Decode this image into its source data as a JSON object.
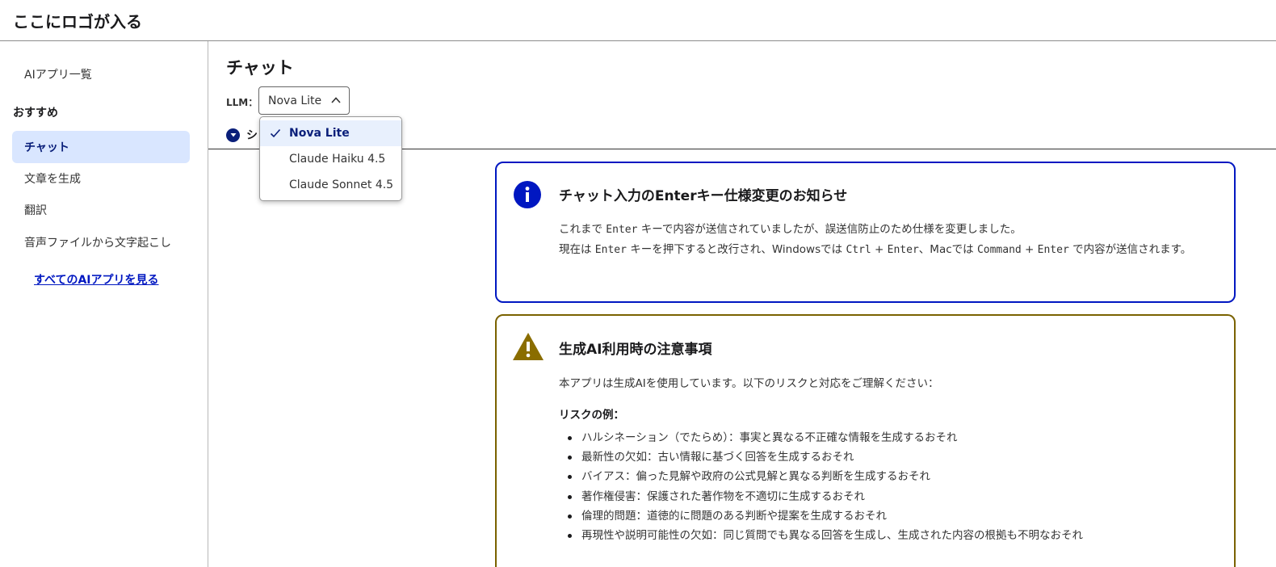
{
  "header": {
    "logo": "ここにロゴが入る"
  },
  "sidebar": {
    "app_list": "AIアプリ一覧",
    "section_heading": "おすすめ",
    "items": [
      {
        "label": "チャット",
        "active": true
      },
      {
        "label": "文章を生成",
        "active": false
      },
      {
        "label": "翻訳",
        "active": false
      },
      {
        "label": "音声ファイルから文字起こし",
        "active": false
      }
    ],
    "all_apps_link": "すべてのAIアプリを見る"
  },
  "main": {
    "title": "チャット",
    "llm_label": "LLM：",
    "llm_selected": "Nova Lite",
    "system_toggle_char": "シ",
    "dropdown_options": [
      {
        "label": "Nova Lite",
        "selected": true
      },
      {
        "label": "Claude Haiku 4.5",
        "selected": false
      },
      {
        "label": "Claude Sonnet 4.5",
        "selected": false
      }
    ]
  },
  "notice": {
    "title": "チャット入力のEnterキー仕様変更のお知らせ",
    "line1_a": "これまで",
    "line1_key": "Enter",
    "line1_b": "キーで内容が送信されていましたが、誤送信防止のため仕様を変更しました。",
    "line2_a": "現在は",
    "line2_key1": "Enter",
    "line2_b": "キーを押下すると改行され、Windowsでは",
    "line2_key2": "Ctrl",
    "line2_plus1": "+",
    "line2_key3": "Enter",
    "line2_c": "、Macでは",
    "line2_key4": "Command",
    "line2_plus2": "+",
    "line2_key5": "Enter",
    "line2_d": "で内容が送信されます。"
  },
  "warning": {
    "title": "生成AI利用時の注意事項",
    "intro": "本アプリは生成AIを使用しています。以下のリスクと対応をご理解ください：",
    "risk_heading": "リスクの例：",
    "risks": [
      "ハルシネーション（でたらめ）：事実と異なる不正確な情報を生成するおそれ",
      "最新性の欠如：古い情報に基づく回答を生成するおそれ",
      "バイアス：偏った見解や政府の公式見解と異なる判断を生成するおそれ",
      "著作権侵害：保護された著作物を不適切に生成するおそれ",
      "倫理的問題：道徳的に問題のある判断や提案を生成するおそれ",
      "再現性や説明可能性の欠如：同じ質問でも異なる回答を生成し、生成された内容の根拠も不明なおそれ"
    ]
  },
  "colors": {
    "info_border": "#0017c1",
    "warning_border": "#7a6200",
    "active_bg": "#d9e6ff",
    "link": "#0017c1"
  },
  "icons": {
    "notice": "info-icon",
    "warning": "warning-triangle-icon",
    "select": "chevron-up-icon",
    "toggle": "chevron-down-circle-icon",
    "dropdown_check": "check-icon"
  }
}
